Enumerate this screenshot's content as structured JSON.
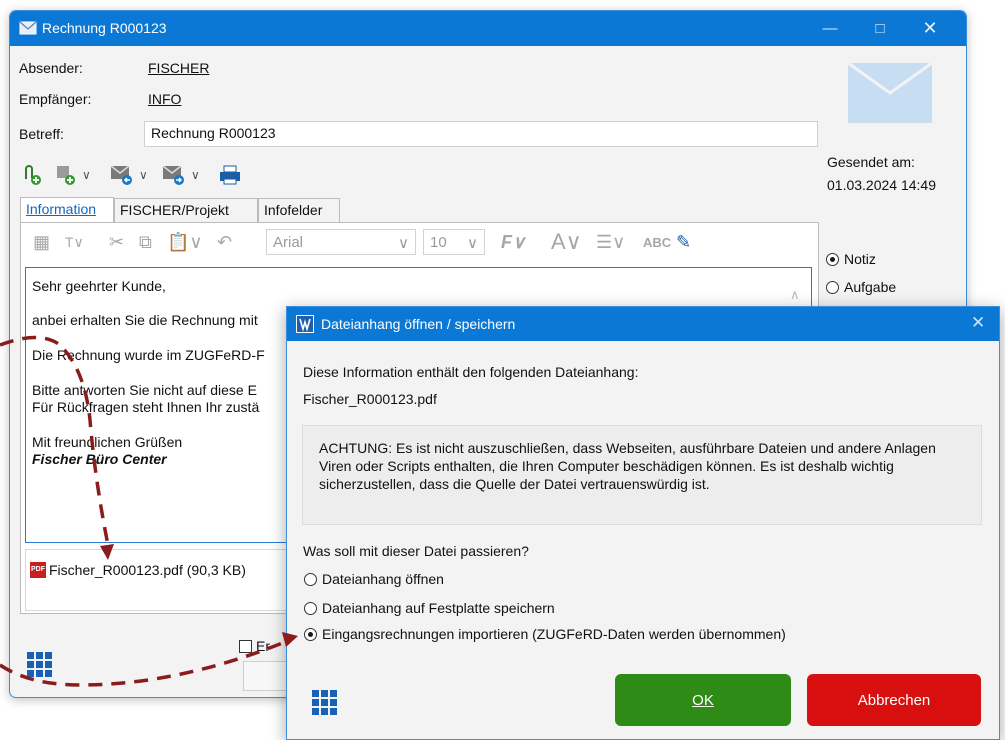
{
  "main_window": {
    "title": "Rechnung R000123",
    "absender_label": "Absender:",
    "absender_value": "FISCHER",
    "empfaenger_label": "Empfänger:",
    "empfaenger_value": "INFO",
    "betreff_label": "Betreff:",
    "betreff_value": "Rechnung R000123",
    "gesendet_label": "Gesendet am:",
    "gesendet_value": "01.03.2024 14:49",
    "tabs": [
      "Information",
      "FISCHER/Projekt",
      "Infofelder"
    ],
    "font_name": "Arial",
    "font_size": "10",
    "body_lines": [
      "Sehr geehrter Kunde,",
      "anbei erhalten Sie die Rechnung mit",
      "Die Rechnung wurde im ZUGFeRD-F",
      "Bitte antworten Sie nicht auf diese E",
      "Für Rückfragen steht Ihnen Ihr zustä",
      "Mit freundlichen Grüßen",
      "Fischer Büro Center"
    ],
    "attachment": "Fischer_R000123.pdf (90,3 KB)",
    "pdf_badge": "PDF",
    "type_options": [
      "Notiz",
      "Aufgabe"
    ],
    "checkbox_partial": "Er"
  },
  "dialog": {
    "title": "Dateianhang öffnen / speichern",
    "intro": "Diese Information enthält den folgenden Dateianhang:",
    "filename": "Fischer_R000123.pdf",
    "warning": "ACHTUNG: Es ist nicht auszuschließen, dass Webseiten, ausführbare Dateien und andere Anlagen Viren oder Scripts enthalten, die Ihren Computer beschädigen können. Es ist deshalb wichtig sicherzustellen, dass die Quelle der Datei vertrauenswürdig ist.",
    "question": "Was soll mit dieser Datei passieren?",
    "options": [
      "Dateianhang öffnen",
      "Dateianhang auf Festplatte speichern",
      "Eingangsrechnungen importieren (ZUGFeRD-Daten werden übernommen)"
    ],
    "selected_option": 2,
    "ok_label": "OK",
    "cancel_label": "Abbrechen"
  },
  "colors": {
    "titlebar": "#0a78d4",
    "ok_button": "#2e8b16",
    "cancel_button": "#d80f0f",
    "annotation_arrow": "#8b1c1c"
  },
  "icons": [
    "envelope-icon",
    "attach-icon",
    "forward-icon",
    "print-icon",
    "grid-menu-icon",
    "pdf-icon",
    "dialog-app-icon"
  ]
}
